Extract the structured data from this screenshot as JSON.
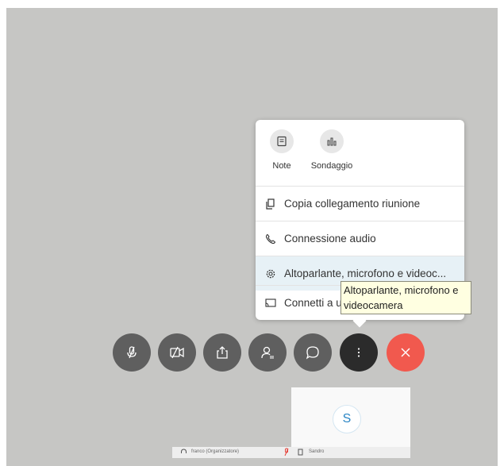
{
  "menu": {
    "top_items": [
      {
        "label": "Note",
        "icon": "notes-icon"
      },
      {
        "label": "Sondaggio",
        "icon": "poll-icon"
      }
    ],
    "items": [
      {
        "label": "Copia collegamento riunione",
        "icon": "copy-icon"
      },
      {
        "label": "Connessione audio",
        "icon": "phone-icon"
      },
      {
        "label": "Altoparlante, microfono e videoc...",
        "icon": "gear-icon"
      },
      {
        "label": "Connetti a un",
        "icon": "cast-icon"
      }
    ]
  },
  "tooltip": {
    "text": "Altoparlante, microfono e videocamera"
  },
  "toolbar": {
    "buttons": [
      {
        "name": "mute-button",
        "icon": "mic-off-icon"
      },
      {
        "name": "video-button",
        "icon": "video-off-icon"
      },
      {
        "name": "share-button",
        "icon": "share-icon"
      },
      {
        "name": "participants-button",
        "icon": "participants-icon"
      },
      {
        "name": "chat-button",
        "icon": "chat-icon"
      },
      {
        "name": "more-button",
        "icon": "more-icon"
      },
      {
        "name": "end-call-button",
        "icon": "close-icon"
      }
    ],
    "colors": {
      "gray": "#5f5f5f",
      "active": "#2b2b2b",
      "end": "#f1594e"
    }
  },
  "self_view": {
    "initial": "S"
  },
  "participants": {
    "organizer": "franco (Organizzatore)",
    "other": "Sandro"
  }
}
